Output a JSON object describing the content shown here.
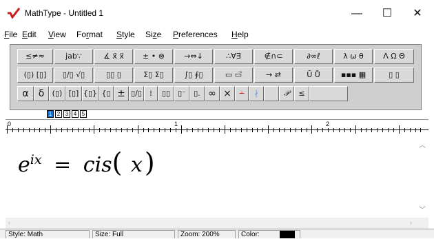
{
  "window": {
    "title": "MathType - Untitled 1",
    "minimize": "—",
    "maximize": "☐",
    "close": "✕"
  },
  "menu": [
    {
      "key": "F",
      "rest": "ile"
    },
    {
      "key": "E",
      "rest": "dit"
    },
    {
      "key": "V",
      "rest": "iew"
    },
    {
      "pre": "Fo",
      "key": "r",
      "rest": "mat"
    },
    {
      "key": "S",
      "rest": "tyle"
    },
    {
      "pre": "Si",
      "key": "z",
      "rest": "e"
    },
    {
      "key": "P",
      "rest": "references"
    },
    {
      "key": "H",
      "rest": "elp"
    }
  ],
  "toolbar": {
    "row1": [
      "≤≠≈",
      "j̇ab∵",
      "∡ ẍ ẍ",
      "± • ⊗",
      "→⇔↓",
      "∴∀∃",
      "∉∩⊂",
      "∂∞ℓ",
      "λ ω θ",
      "Λ Ω Θ"
    ],
    "row2": [
      "(▯) [▯]",
      "▯/▯ √▯",
      "▯▯ ▯",
      "Σ▯ Σ▯",
      "∫▯ ∮▯",
      "▭ ▭⃗",
      "→ ⇄",
      "Ū Ů",
      "▪▪▪ ▦",
      "▯ ▯"
    ],
    "row3": [
      "α",
      "δ",
      "(▯)",
      "[▯]",
      "{▯}",
      "{▯",
      "±",
      "▯/▯",
      "⁞",
      "▯▯",
      "▯⁻",
      "▯.",
      "∞",
      "×",
      "∸",
      "∤",
      "",
      "𝒫",
      "≤",
      ""
    ]
  },
  "tabs": [
    "1",
    "2",
    "3",
    "4",
    "5"
  ],
  "ruler": {
    "labels": [
      "0",
      "1",
      "2"
    ]
  },
  "equation": {
    "base": "e",
    "exponent": "ix",
    "equals": "=",
    "func": "cis",
    "lparen": "(",
    "arg": "x",
    "rparen": ")"
  },
  "status": {
    "style": "Style: Math",
    "size": "Size: Full",
    "zoom": "Zoom: 200%",
    "color": "Color:",
    "color_value": "#000000"
  }
}
